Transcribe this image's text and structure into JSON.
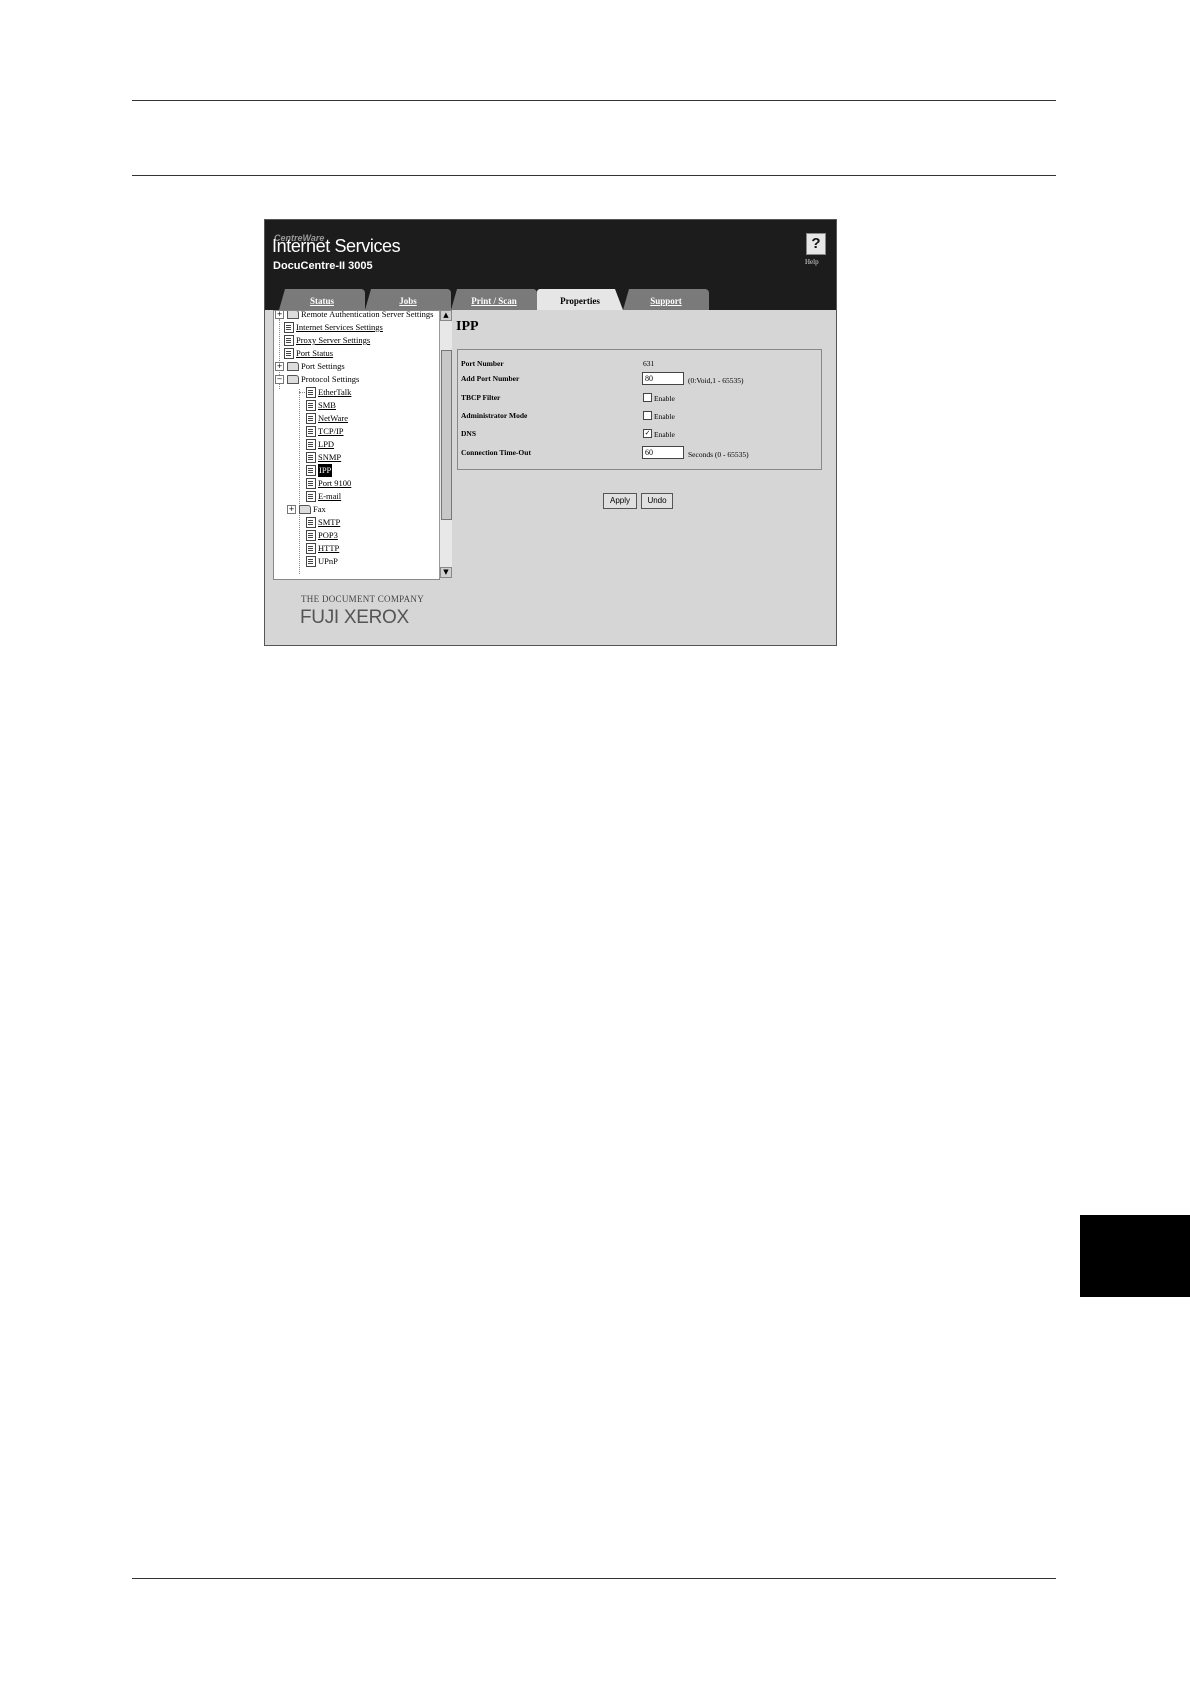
{
  "app": {
    "brand_small": "CentreWare",
    "brand_title": "Internet Services",
    "model": "DocuCentre-II 3005",
    "help_icon": "?",
    "help_label": "Help"
  },
  "tabs": [
    {
      "label": "Status"
    },
    {
      "label": "Jobs"
    },
    {
      "label": "Print / Scan"
    },
    {
      "label": "Properties"
    },
    {
      "label": "Support"
    }
  ],
  "tree": {
    "items": [
      {
        "label": "Remote Authentication Server Settings",
        "expander": "+"
      },
      {
        "label": "Internet Services Settings"
      },
      {
        "label": "Proxy Server Settings"
      },
      {
        "label": "Port Status"
      },
      {
        "label": "Port Settings",
        "expander": "+"
      },
      {
        "label": "Protocol Settings",
        "expander": "−"
      },
      {
        "label": "EtherTalk"
      },
      {
        "label": "SMB"
      },
      {
        "label": "NetWare"
      },
      {
        "label": "TCP/IP"
      },
      {
        "label": "LPD"
      },
      {
        "label": "SNMP"
      },
      {
        "label": "IPP"
      },
      {
        "label": "Port 9100"
      },
      {
        "label": "E-mail"
      },
      {
        "label": "Fax",
        "expander": "+"
      },
      {
        "label": "SMTP"
      },
      {
        "label": "POP3"
      },
      {
        "label": "HTTP"
      },
      {
        "label": "UPnP"
      }
    ],
    "scroll_up": "▲",
    "scroll_down": "▼"
  },
  "footer": {
    "company": "THE DOCUMENT COMPANY",
    "brand": "FUJI XEROX"
  },
  "main": {
    "title": "IPP",
    "fields": {
      "port_number": {
        "label": "Port Number",
        "value": "631"
      },
      "add_port_number": {
        "label": "Add Port Number",
        "value": "80",
        "hint": "(0:Void,1 - 65535)"
      },
      "tbcp_filter": {
        "label": "TBCP Filter",
        "option": "Enable",
        "checked": false
      },
      "admin_mode": {
        "label": "Administrator Mode",
        "option": "Enable",
        "checked": false
      },
      "dns": {
        "label": "DNS",
        "option": "Enable",
        "checked": true,
        "check_mark": "✓"
      },
      "timeout": {
        "label": "Connection Time-Out",
        "value": "60",
        "hint": "Seconds (0 - 65535)"
      }
    },
    "apply_label": "Apply",
    "undo_label": "Undo"
  }
}
